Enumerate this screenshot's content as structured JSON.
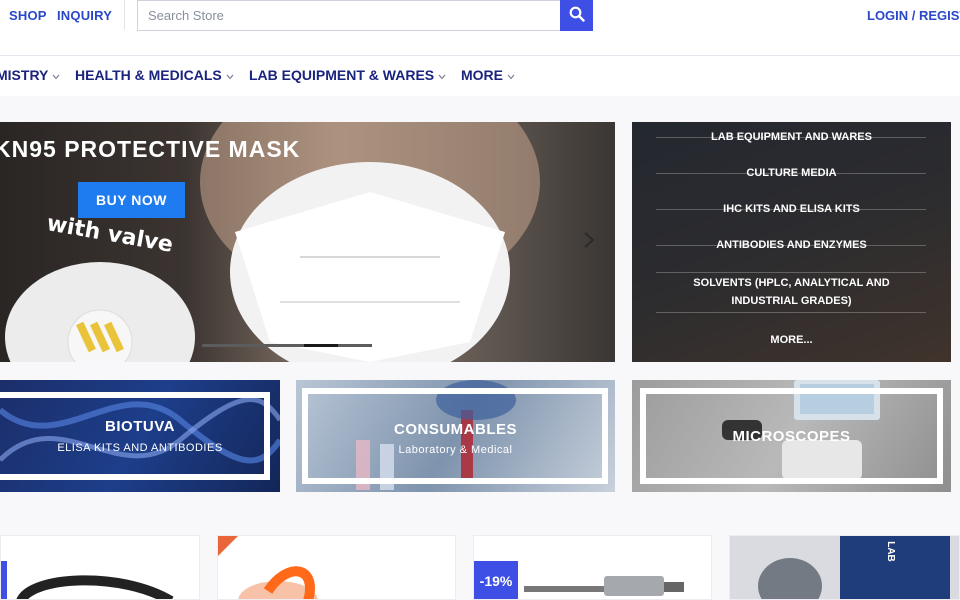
{
  "topbar": {
    "shop": "SHOP",
    "inquiry": "INQUIRY",
    "search_placeholder": "Search Store",
    "login": "LOGIN / REGIST"
  },
  "nav": {
    "items": [
      {
        "label": "MISTRY"
      },
      {
        "label": "HEALTH & MEDICALS"
      },
      {
        "label": "LAB EQUIPMENT & WARES"
      },
      {
        "label": "MORE"
      }
    ]
  },
  "hero": {
    "title": "KN95 PROTECTIVE MASK",
    "button": "BUY NOW",
    "caption": "with valve"
  },
  "categories": {
    "items": [
      "LAB EQUIPMENT AND WARES",
      "CULTURE MEDIA",
      "IHC KITS AND ELISA KITS",
      "ANTIBODIES AND ENZYMES",
      "SOLVENTS (HPLC, ANALYTICAL AND",
      "INDUSTRIAL GRADES)",
      "MORE..."
    ]
  },
  "banners": {
    "b1": {
      "title": "BIOTUVA",
      "subtitle": "ELISA KITS AND ANTIBODIES"
    },
    "b2": {
      "title": "CONSUMABLES",
      "subtitle": "Laboratory & Medical"
    },
    "b3": {
      "title": "MICROSCOPES"
    }
  },
  "products": {
    "badge": "-19%",
    "box_text": "LAB"
  },
  "colors": {
    "accent": "#3e4fe6",
    "nav_text": "#1a237e",
    "link": "#2a48c8",
    "buy_button": "#1e7bf0"
  }
}
